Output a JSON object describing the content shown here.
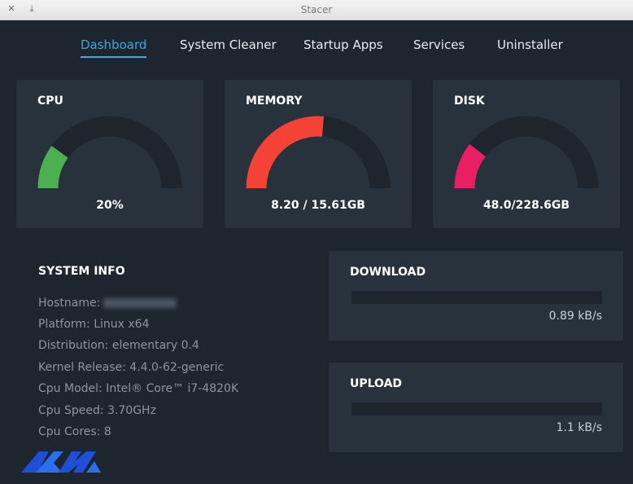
{
  "window": {
    "title": "Stacer"
  },
  "nav": {
    "tabs": [
      {
        "label": "Dashboard",
        "active": true
      },
      {
        "label": "System Cleaner",
        "active": false
      },
      {
        "label": "Startup Apps",
        "active": false
      },
      {
        "label": "Services",
        "active": false
      },
      {
        "label": "Uninstaller",
        "active": false
      }
    ]
  },
  "gauges": {
    "cpu": {
      "title": "CPU",
      "value_label": "20%",
      "fraction": 0.2,
      "color": "#4caf50"
    },
    "memory": {
      "title": "MEMORY",
      "value_label": "8.20 / 15.61GB",
      "fraction": 0.525,
      "color": "#f44336"
    },
    "disk": {
      "title": "DISK",
      "value_label": "48.0/228.6GB",
      "fraction": 0.21,
      "color": "#e91e63"
    }
  },
  "system_info": {
    "title": "SYSTEM INFO",
    "lines": [
      "Hostname:",
      "Platform: Linux x64",
      "Distribution: elementary 0.4",
      "Kernel Release: 4.4.0-62-generic",
      "Cpu Model: Intel® Core™ i7-4820K",
      "Cpu Speed: 3.70GHz",
      "Cpu Cores: 8"
    ]
  },
  "network": {
    "download": {
      "title": "DOWNLOAD",
      "rate": "0.89 kB/s",
      "fraction": 0.0
    },
    "upload": {
      "title": "UPLOAD",
      "rate": "1.1 kB/s",
      "fraction": 0.0
    }
  },
  "colors": {
    "accent": "#3da7e3",
    "track": "#1e252d",
    "card": "#28323d",
    "background": "#1d252e"
  }
}
